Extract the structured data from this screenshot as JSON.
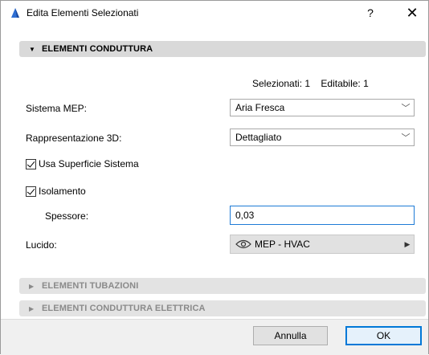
{
  "window": {
    "title": "Edita Elementi Selezionati",
    "help": "?",
    "close": "✕"
  },
  "section_main": {
    "label": "ELEMENTI CONDUTTURA",
    "expanded": true
  },
  "counts": {
    "selected": "Selezionati: 1",
    "editable": "Editabile: 1"
  },
  "fields": {
    "mep_label": "Sistema MEP:",
    "mep_value": "Aria Fresca",
    "rep3d_label": "Rappresentazione 3D:",
    "rep3d_value": "Dettagliato",
    "use_surface_label": "Usa Superficie Sistema",
    "insulation_label": "Isolamento",
    "thickness_label": "Spessore:",
    "thickness_value": "0,03",
    "layer_label": "Lucido:",
    "layer_value": "MEP - HVAC"
  },
  "sections_collapsed": [
    {
      "label": "ELEMENTI TUBAZIONI"
    },
    {
      "label": "ELEMENTI CONDUTTURA ELETTRICA"
    }
  ],
  "buttons": {
    "cancel": "Annulla",
    "ok": "OK"
  },
  "colors": {
    "accent": "#0078d7",
    "section_bg": "#d9d9d9",
    "app_icon": "#2f6fd3"
  }
}
